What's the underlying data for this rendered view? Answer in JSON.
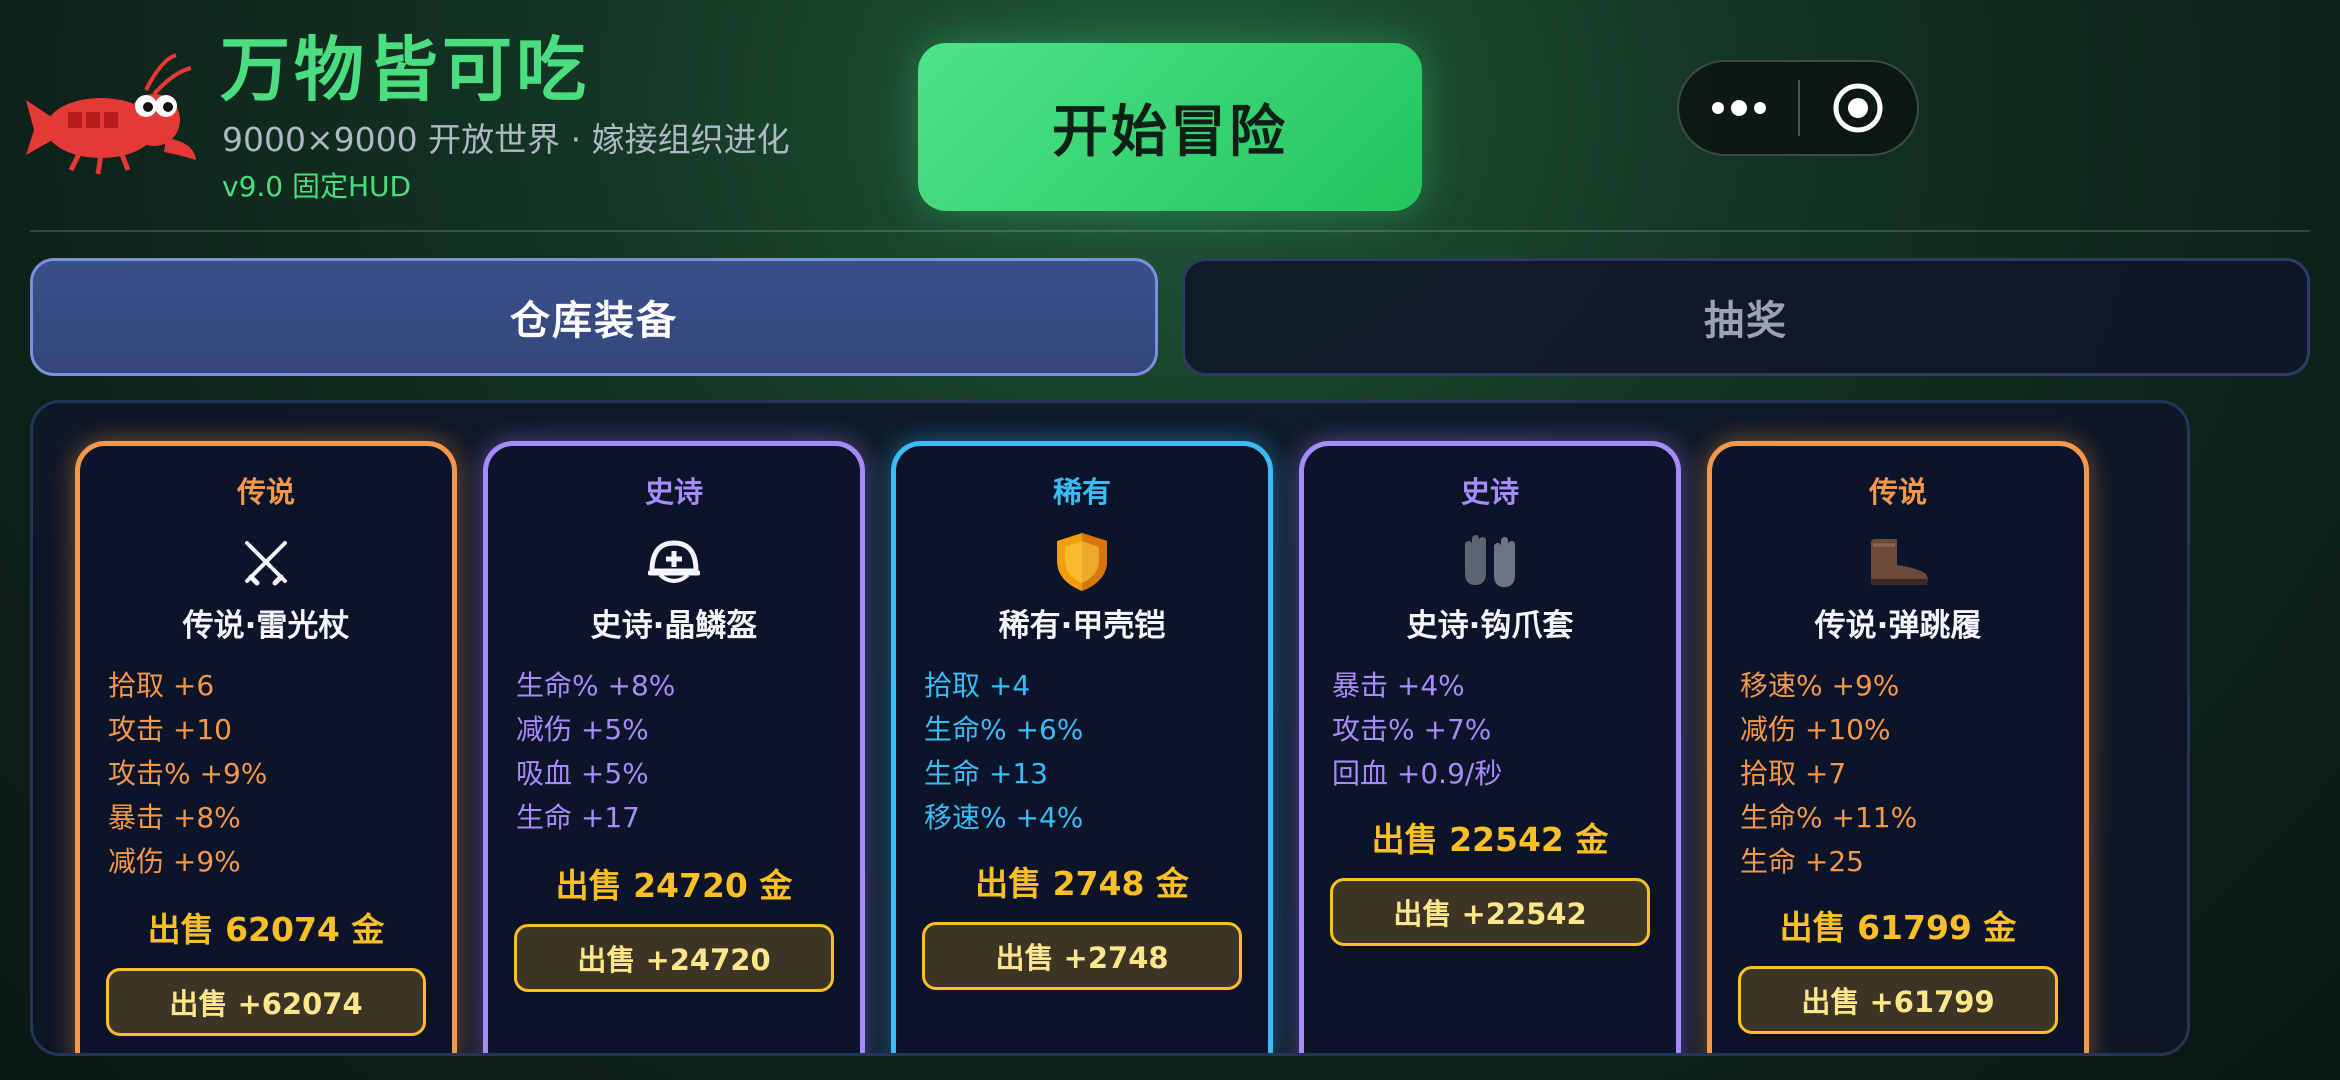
{
  "header": {
    "title": "万物皆可吃",
    "subtitle": "9000×9000 开放世界 · 嫁接组织进化",
    "version": "v9.0 固定HUD",
    "start_button": "开始冒险",
    "logo_icon": "lobster-icon"
  },
  "capsule": {
    "more_icon": "more-dots-icon",
    "close_icon": "target-close-icon"
  },
  "tabs": [
    {
      "label": "仓库装备",
      "active": true
    },
    {
      "label": "抽奖",
      "active": false
    }
  ],
  "colors": {
    "legend": "#f5974a",
    "epic": "#a78bfa",
    "rare": "#38bdf8",
    "gold": "#fbbf24",
    "accent_green": "#4ade80"
  },
  "cards": [
    {
      "rarity": "传说",
      "tier": "legend",
      "icon": "crossed-swords-icon",
      "name": "传说·雷光杖",
      "stats": [
        "拾取 +6",
        "攻击 +10",
        "攻击% +9%",
        "暴击 +8%",
        "减伤 +9%"
      ],
      "price": "出售 62074 金",
      "sell_button": "出售 +62074"
    },
    {
      "rarity": "史诗",
      "tier": "epic",
      "icon": "rescue-helmet-icon",
      "name": "史诗·晶鳞盔",
      "stats": [
        "生命% +8%",
        "减伤 +5%",
        "吸血 +5%",
        "生命 +17"
      ],
      "price": "出售 24720 金",
      "sell_button": "出售 +24720"
    },
    {
      "rarity": "稀有",
      "tier": "rare",
      "icon": "shield-icon",
      "name": "稀有·甲壳铠",
      "stats": [
        "拾取 +4",
        "生命% +6%",
        "生命 +13",
        "移速% +4%"
      ],
      "price": "出售 2748 金",
      "sell_button": "出售 +2748"
    },
    {
      "rarity": "史诗",
      "tier": "epic",
      "icon": "gloves-icon",
      "name": "史诗·钩爪套",
      "stats": [
        "暴击 +4%",
        "攻击% +7%",
        "回血 +0.9/秒"
      ],
      "price": "出售 22542 金",
      "sell_button": "出售 +22542"
    },
    {
      "rarity": "传说",
      "tier": "legend",
      "icon": "boot-icon",
      "name": "传说·弹跳履",
      "stats": [
        "移速% +9%",
        "减伤 +10%",
        "拾取 +7",
        "生命% +11%",
        "生命 +25"
      ],
      "price": "出售 61799 金",
      "sell_button": "出售 +61799"
    }
  ]
}
